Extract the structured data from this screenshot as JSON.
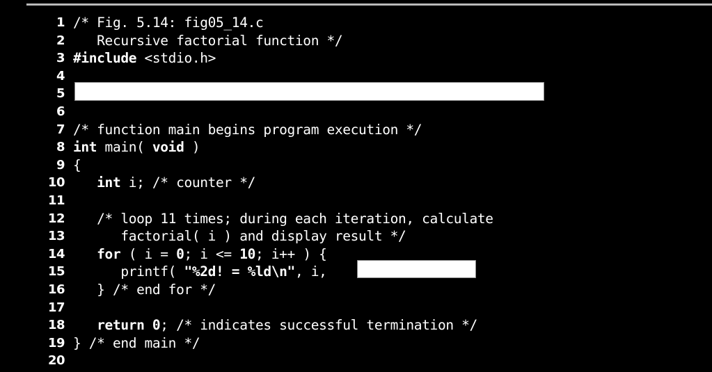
{
  "figure": {
    "caption_ref": "Fig. 5.14",
    "file_name": "fig05_14.c",
    "description": "Recursive factorial function"
  },
  "colors": {
    "background": "#000000",
    "text": "#ffffff",
    "rule": "#b9b9b9",
    "blank_fill": "#ffffff",
    "blank_border": "#8c8c8c"
  },
  "code": {
    "lines": [
      {
        "n": "1",
        "segments": [
          {
            "text": "/* Fig. 5.14: fig05_14.c",
            "bold": false
          }
        ]
      },
      {
        "n": "2",
        "segments": [
          {
            "text": "   Recursive factorial function */",
            "bold": false
          }
        ]
      },
      {
        "n": "3",
        "segments": [
          {
            "text": "#include",
            "bold": true
          },
          {
            "text": " <stdio.h>",
            "bold": false
          }
        ]
      },
      {
        "n": "4",
        "segments": [
          {
            "text": "",
            "bold": false
          }
        ]
      },
      {
        "n": "5",
        "segments": [
          {
            "text": "",
            "bold": false
          }
        ]
      },
      {
        "n": "6",
        "segments": [
          {
            "text": "",
            "bold": false
          }
        ]
      },
      {
        "n": "7",
        "segments": [
          {
            "text": "/* function main begins program execution */",
            "bold": false
          }
        ]
      },
      {
        "n": "8",
        "segments": [
          {
            "text": "int",
            "bold": true
          },
          {
            "text": " main( ",
            "bold": false
          },
          {
            "text": "void",
            "bold": true
          },
          {
            "text": " )",
            "bold": false
          }
        ]
      },
      {
        "n": "9",
        "segments": [
          {
            "text": "{",
            "bold": false
          }
        ]
      },
      {
        "n": "10",
        "segments": [
          {
            "text": "   ",
            "bold": false
          },
          {
            "text": "int",
            "bold": true
          },
          {
            "text": " i; /* counter */",
            "bold": false
          }
        ]
      },
      {
        "n": "11",
        "segments": [
          {
            "text": "",
            "bold": false
          }
        ]
      },
      {
        "n": "12",
        "segments": [
          {
            "text": "   /* loop 11 times; during each iteration, calculate",
            "bold": false
          }
        ]
      },
      {
        "n": "13",
        "segments": [
          {
            "text": "      factorial( i ) and display result */",
            "bold": false
          }
        ]
      },
      {
        "n": "14",
        "segments": [
          {
            "text": "   ",
            "bold": false
          },
          {
            "text": "for",
            "bold": true
          },
          {
            "text": " ( i = ",
            "bold": false
          },
          {
            "text": "0",
            "bold": true
          },
          {
            "text": "; i <= ",
            "bold": false
          },
          {
            "text": "10",
            "bold": true
          },
          {
            "text": "; i++ ) {",
            "bold": false
          }
        ]
      },
      {
        "n": "15",
        "segments": [
          {
            "text": "      printf( ",
            "bold": false
          },
          {
            "text": "\"%2d! = %ld\\n\"",
            "bold": true
          },
          {
            "text": ", i,                );",
            "bold": false
          }
        ]
      },
      {
        "n": "16",
        "segments": [
          {
            "text": "   } /* end for */",
            "bold": false
          }
        ]
      },
      {
        "n": "17",
        "segments": [
          {
            "text": "",
            "bold": false
          }
        ]
      },
      {
        "n": "18",
        "segments": [
          {
            "text": "   ",
            "bold": false
          },
          {
            "text": "return 0",
            "bold": true
          },
          {
            "text": "; /* indicates successful termination */",
            "bold": false
          }
        ]
      },
      {
        "n": "19",
        "segments": [
          {
            "text": "} /* end main */",
            "bold": false
          }
        ]
      },
      {
        "n": "20",
        "segments": [
          {
            "text": "",
            "bold": false
          }
        ]
      }
    ]
  },
  "blanks": [
    {
      "id": "blank-line5",
      "line": "5",
      "value": "",
      "placeholder": ""
    },
    {
      "id": "blank-line15",
      "line": "15",
      "value": "",
      "placeholder": ""
    }
  ]
}
